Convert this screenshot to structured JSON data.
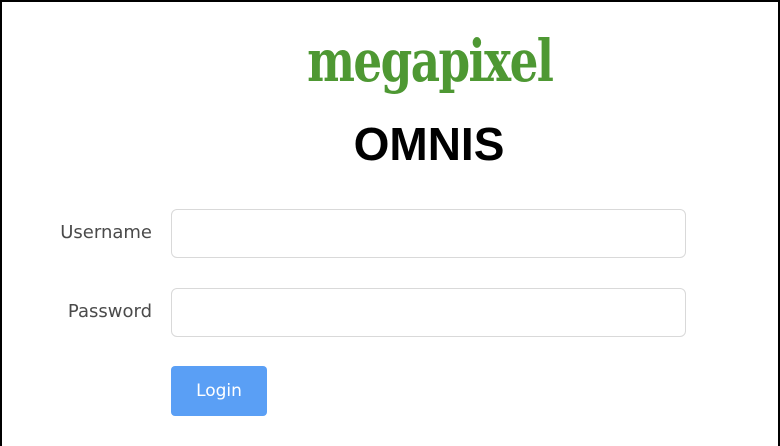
{
  "brand": {
    "logo_text": "megapixel",
    "logo_color": "#4e9833"
  },
  "app": {
    "title": "OMNIS"
  },
  "form": {
    "username_label": "Username",
    "username_value": "",
    "username_placeholder": "",
    "password_label": "Password",
    "password_value": "",
    "password_placeholder": "",
    "login_label": "Login",
    "login_color": "#5a9ff5"
  }
}
